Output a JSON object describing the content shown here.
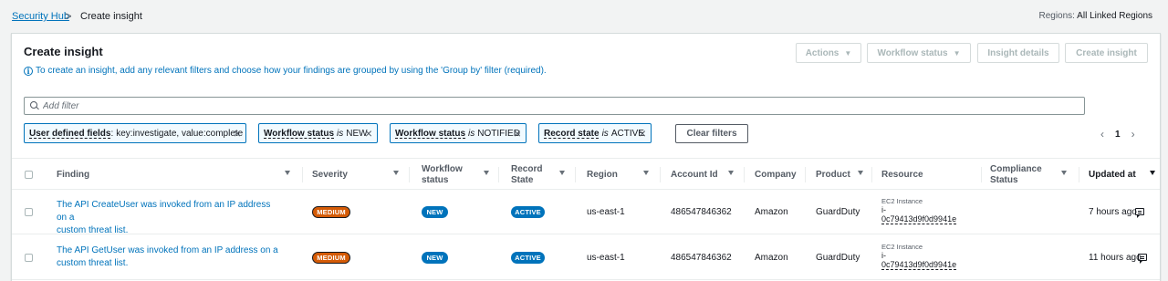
{
  "breadcrumb": {
    "root": "Security Hub",
    "separator": ">",
    "current": "Create insight"
  },
  "regions": {
    "label": "Regions:",
    "value": "All Linked Regions"
  },
  "panel": {
    "title": "Create insight",
    "info": "To create an insight, add any relevant filters and choose how your findings are grouped by using the 'Group by' filter (required).",
    "info_icon": "info-icon"
  },
  "header_buttons": {
    "actions": "Actions",
    "workflow_status": "Workflow status",
    "insight_details": "Insight details",
    "create_insight": "Create insight"
  },
  "search": {
    "placeholder": "Add filter",
    "value": ""
  },
  "filters": [
    {
      "key": "User defined fields",
      "op": ":",
      "value": "key:investigate, value:complete"
    },
    {
      "key": "Workflow status",
      "op": "is",
      "value": "NEW"
    },
    {
      "key": "Workflow status",
      "op": "is",
      "value": "NOTIFIED"
    },
    {
      "key": "Record state",
      "op": "is",
      "value": "ACTIVE"
    }
  ],
  "clear_filters": "Clear filters",
  "pagination": {
    "page": "1",
    "prev": "‹",
    "next": "›"
  },
  "columns": {
    "finding": "Finding",
    "severity": "Severity",
    "workflow_status_1": "Workflow",
    "workflow_status_2": "status",
    "record_state_1": "Record",
    "record_state_2": "State",
    "region": "Region",
    "account_id": "Account Id",
    "company": "Company",
    "product": "Product",
    "resource": "Resource",
    "compliance_1": "Compliance",
    "compliance_2": "Status",
    "updated_at": "Updated at"
  },
  "rows": [
    {
      "finding_line1": "The API CreateUser was invoked from an IP address on a",
      "finding_line2": "custom threat list.",
      "severity": "MEDIUM",
      "workflow": "NEW",
      "record_state": "ACTIVE",
      "region": "us-east-1",
      "account_id": "486547846362",
      "company": "Amazon",
      "product": "GuardDuty",
      "resource_type": "EC2 Instance",
      "resource_id_1": "i-",
      "resource_id_2": "0c79413d9f0d9941e",
      "updated": "7 hours ago"
    },
    {
      "finding_line1": "The API GetUser was invoked from an IP address on a",
      "finding_line2": "custom threat list.",
      "severity": "MEDIUM",
      "workflow": "NEW",
      "record_state": "ACTIVE",
      "region": "us-east-1",
      "account_id": "486547846362",
      "company": "Amazon",
      "product": "GuardDuty",
      "resource_type": "EC2 Instance",
      "resource_id_1": "i-",
      "resource_id_2": "0c79413d9f0d9941e",
      "updated": "11 hours ago"
    }
  ],
  "colors": {
    "link": "#0073bb",
    "severity_medium": "#d45b07",
    "badge_blue": "#0073bb"
  }
}
